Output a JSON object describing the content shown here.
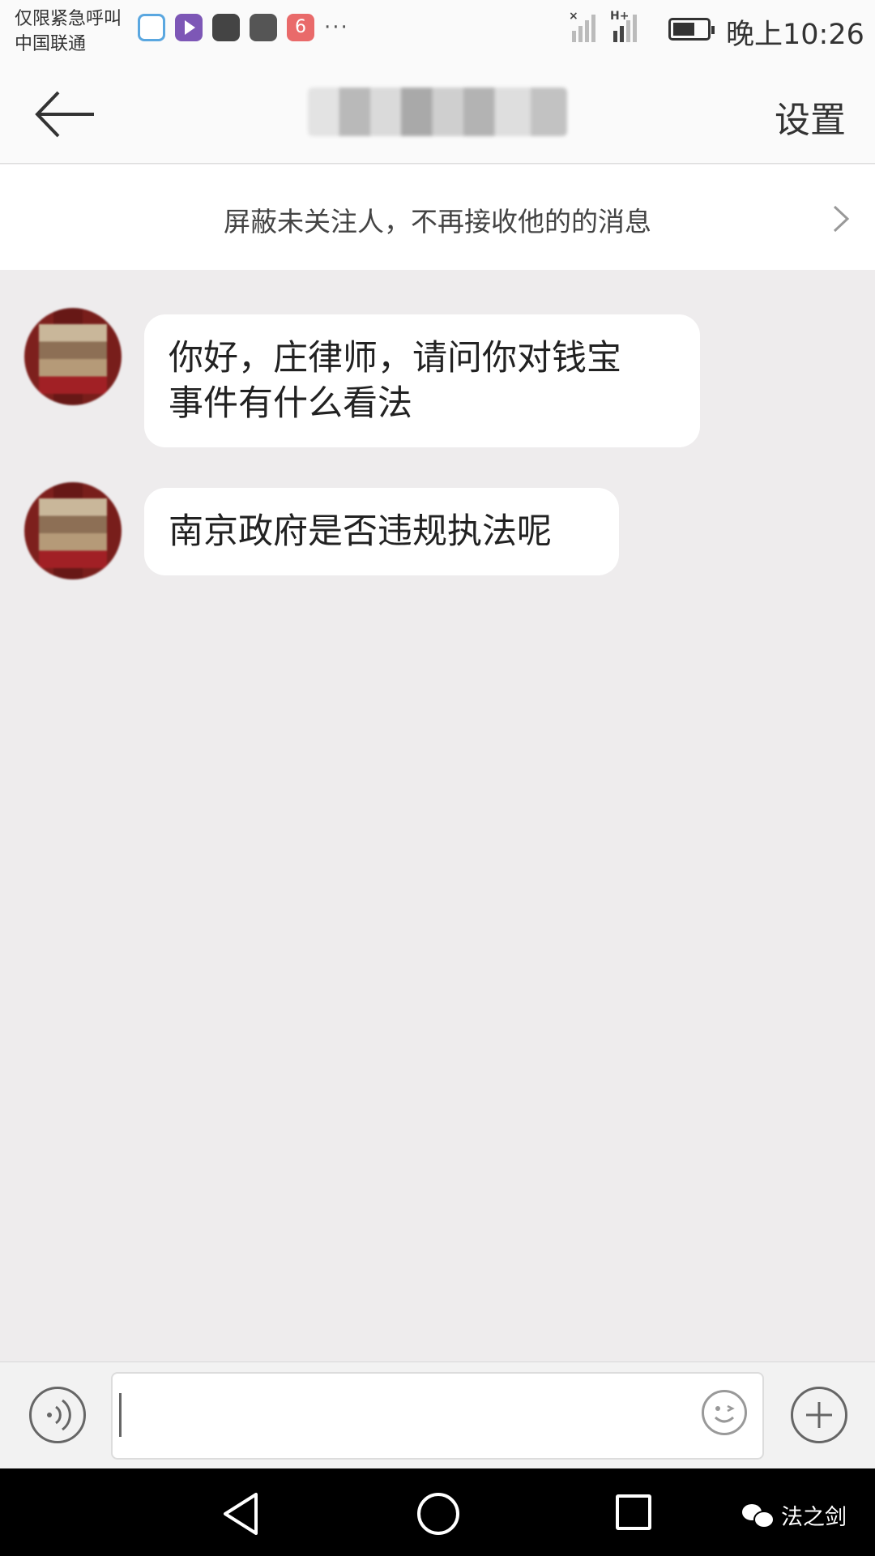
{
  "status_bar": {
    "carrier_line1": "仅限紧急呼叫",
    "carrier_line2": "中国联通",
    "notification_icons": [
      "qq-icon",
      "video-app-icon",
      "hand-stop-icon",
      "baidu-paw-icon",
      "weibo-icon"
    ],
    "more": "···",
    "network_tag": "H+",
    "time": "晚上10:26"
  },
  "header": {
    "settings_label": "设置"
  },
  "notice": {
    "text": "屏蔽未关注人，不再接收他的的消息"
  },
  "messages": [
    {
      "side": "left",
      "line1": "你好，庄律师，请问你对钱宝",
      "line2": "事件有什么看法"
    },
    {
      "side": "left",
      "line1": "南京政府是否违规执法呢"
    }
  ],
  "input": {
    "placeholder": ""
  },
  "watermark": {
    "text": "法之剑"
  },
  "colors": {
    "chat_background": "#eeeced",
    "bubble": "#ffffff",
    "nav_bar": "#000000"
  }
}
